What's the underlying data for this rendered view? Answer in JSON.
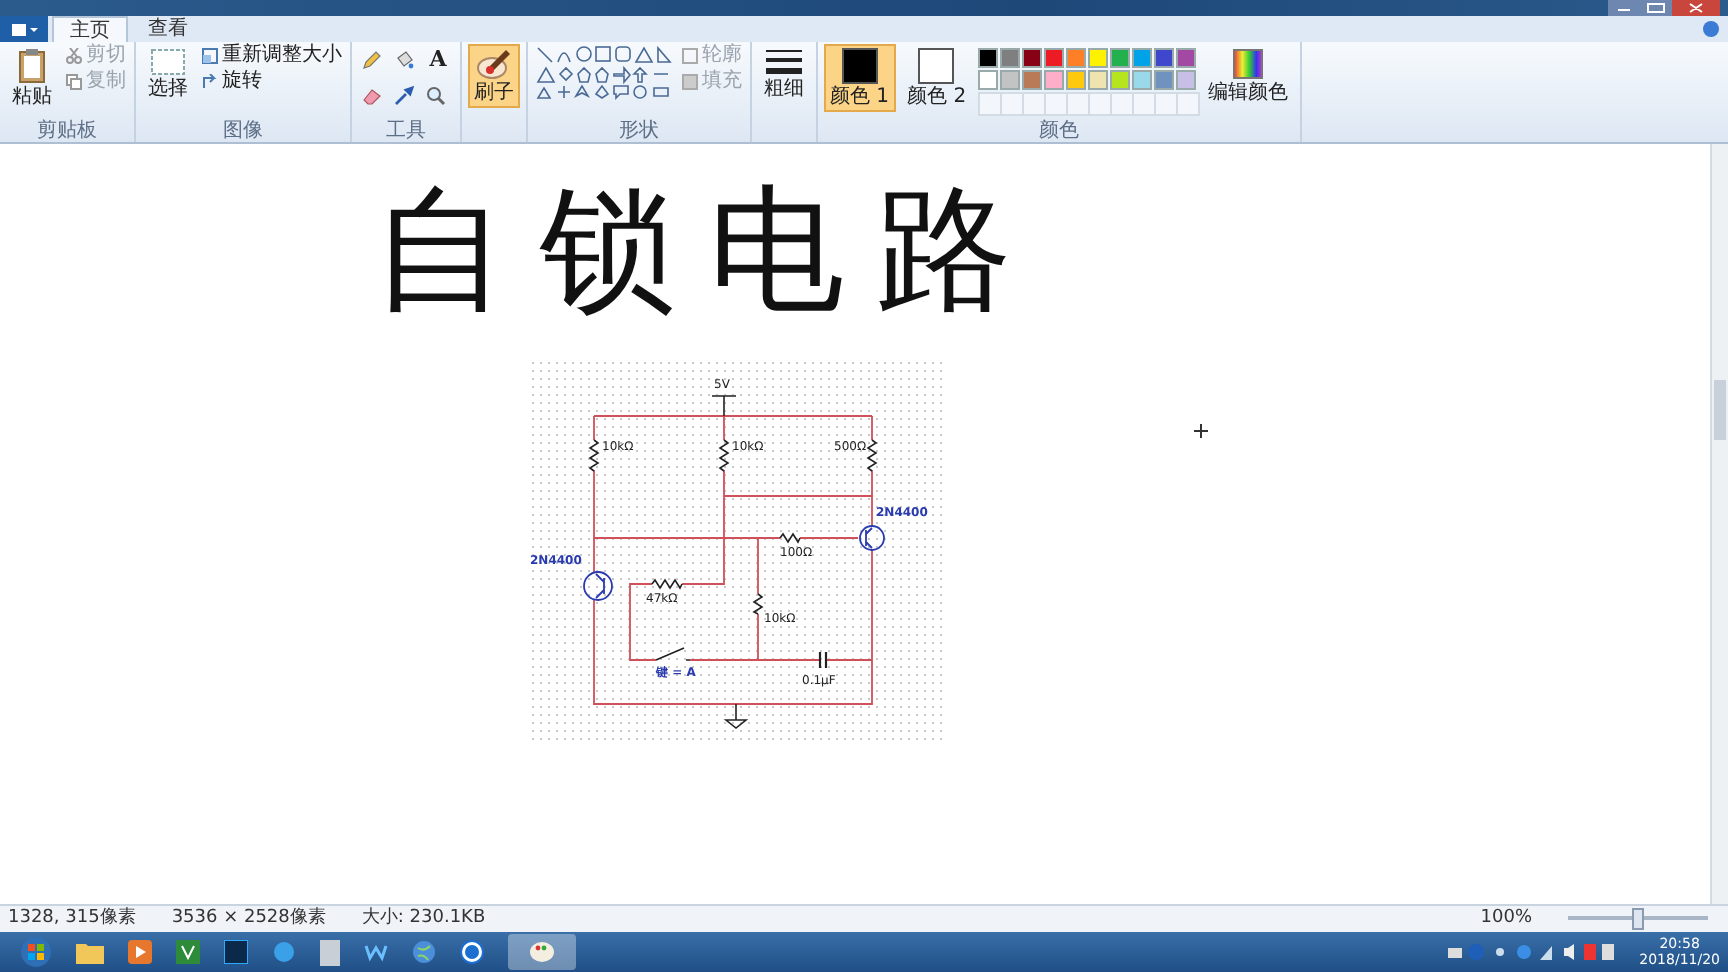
{
  "tabs": [
    {
      "label": "主页",
      "selected": true
    },
    {
      "label": "查看",
      "selected": false
    }
  ],
  "clipboard": {
    "label": "剪贴板",
    "paste": "粘贴",
    "cut": {
      "label": "剪切",
      "disabled": true
    },
    "copy": {
      "label": "复制",
      "disabled": true
    }
  },
  "image": {
    "label": "图像",
    "select": "选择",
    "resize": "重新调整大小",
    "rotate": "旋转"
  },
  "tools": {
    "label": "工具",
    "text_glyph": "A"
  },
  "brush": {
    "label": "刷子",
    "selected": true
  },
  "shapes": {
    "label": "形状",
    "outline": {
      "label": "轮廓",
      "disabled": true
    },
    "fill": {
      "label": "填充",
      "disabled": true
    }
  },
  "size": {
    "label": "粗细"
  },
  "colors": {
    "label": "颜色",
    "color1": {
      "label": "颜色 1",
      "color": "#000000",
      "selected": true
    },
    "color2": {
      "label": "颜色 2",
      "color": "#ffffff",
      "selected": false
    },
    "edit": "编辑颜色",
    "palette": [
      {
        "color": "#000000"
      },
      {
        "color": "#7f7f7f"
      },
      {
        "color": "#880015"
      },
      {
        "color": "#ed1c24"
      },
      {
        "color": "#ff7f27"
      },
      {
        "color": "#fff200"
      },
      {
        "color": "#22b14c"
      },
      {
        "color": "#00a2e8"
      },
      {
        "color": "#3f48cc"
      },
      {
        "color": "#a349a4"
      },
      {
        "color": "#ffffff"
      },
      {
        "color": "#c3c3c3"
      },
      {
        "color": "#b97a57"
      },
      {
        "color": "#ffaec9"
      },
      {
        "color": "#ffc90e"
      },
      {
        "color": "#efe4b0"
      },
      {
        "color": "#b5e61d"
      },
      {
        "color": "#99d9ea"
      },
      {
        "color": "#7092be"
      },
      {
        "color": "#c8bfe7"
      }
    ]
  },
  "canvas": {
    "heading": "自锁电路",
    "circuit": {
      "supply": "5V",
      "r1": "10kΩ",
      "r2": "10kΩ",
      "r3": "500Ω",
      "q1": "2N4400",
      "q2": "2N4400",
      "r4": "100Ω",
      "r5": "47kΩ",
      "r6": "10kΩ",
      "switch": "键 = A",
      "cap": "0.1µF"
    }
  },
  "status_bar": {
    "cursor": "1328, 315像素",
    "dimensions": "3536 × 2528像素",
    "file_size": "大小: 230.1KB",
    "zoom": "100%",
    "zoom_slider": {
      "level": 0.5
    }
  },
  "taskbar": {
    "time": "20:58",
    "date": "2018/11/20"
  }
}
